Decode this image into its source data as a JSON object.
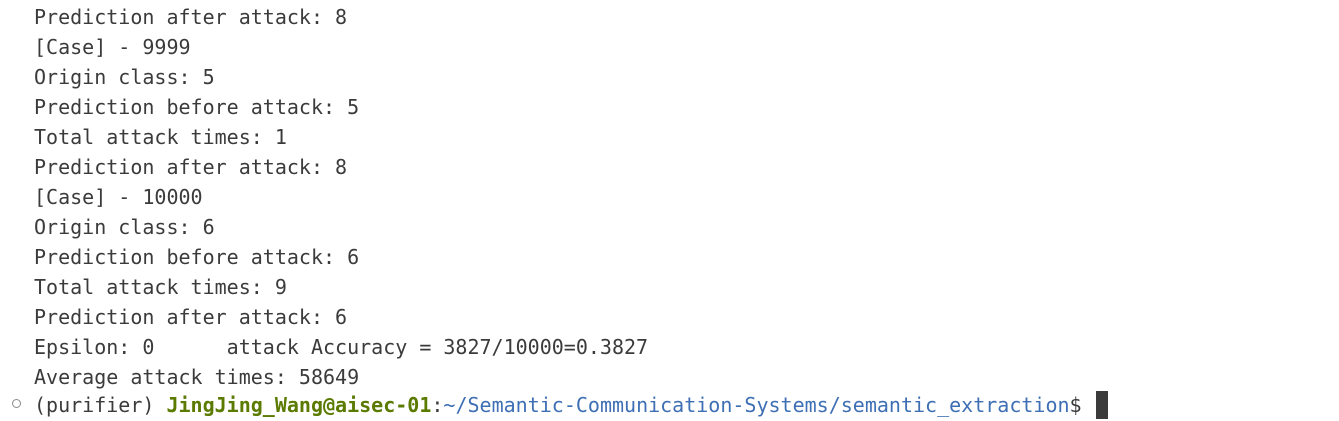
{
  "terminal": {
    "lines": [
      "Prediction after attack: 8",
      "[Case] - 9999",
      "Origin class: 5",
      "Prediction before attack: 5",
      "Total attack times: 1",
      "Prediction after attack: 8",
      "[Case] - 10000",
      "Origin class: 6",
      "Prediction before attack: 6",
      "Total attack times: 9",
      "Prediction after attack: 6",
      "Epsilon: 0      attack Accuracy = 3827/10000=0.3827",
      "Average attack times: 58649"
    ],
    "prompt": {
      "env": "(purifier) ",
      "user_host": "JingJing_Wang@aisec-01",
      "separator": ":",
      "path": "~/Semantic-Communication-Systems/semantic_extraction",
      "symbol": "$"
    }
  }
}
